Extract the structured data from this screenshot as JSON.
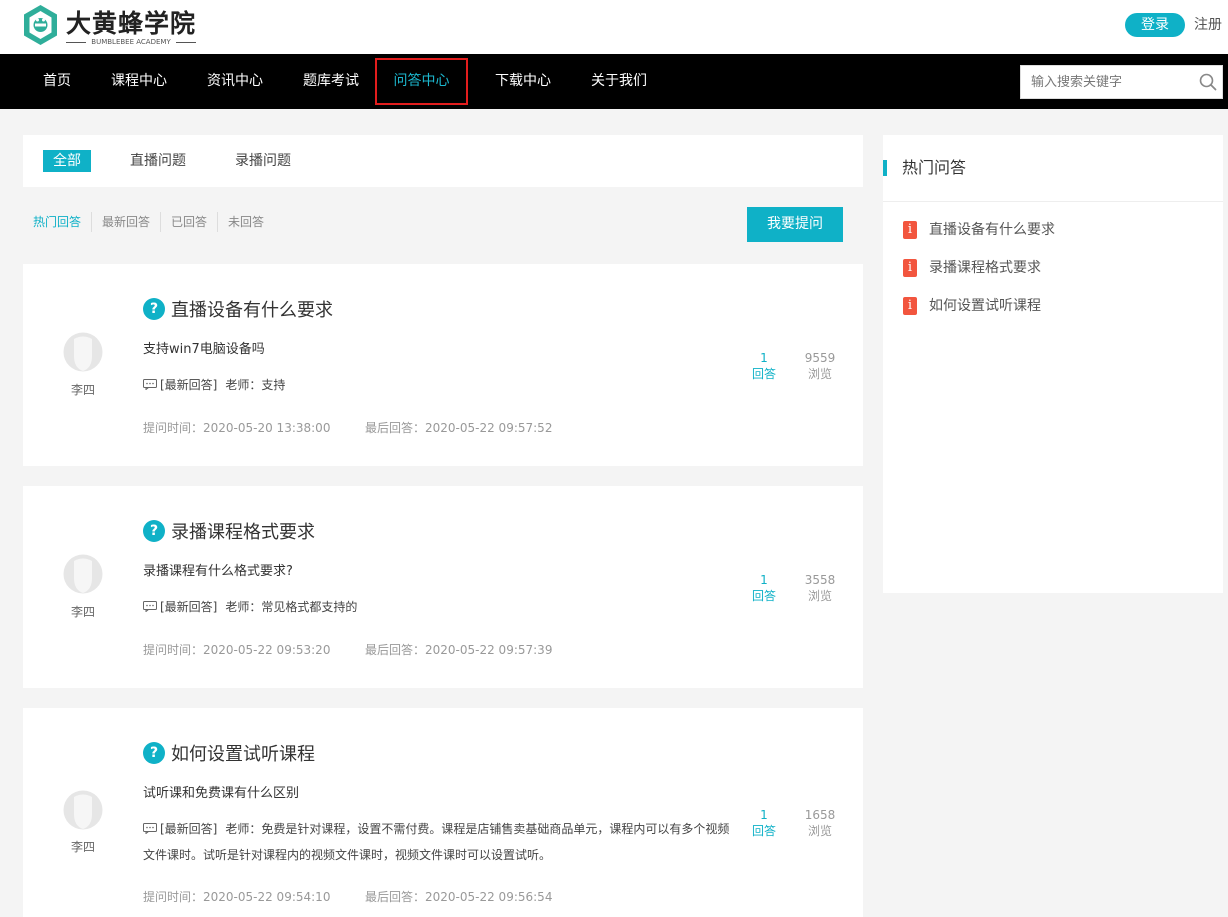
{
  "brand": {
    "name": "大黄蜂学院",
    "subtitle": "BUMBLEBEE ACADEMY"
  },
  "header": {
    "login_label": "登录",
    "register_label": "注册"
  },
  "nav": {
    "items": [
      {
        "label": "首页"
      },
      {
        "label": "课程中心"
      },
      {
        "label": "资讯中心"
      },
      {
        "label": "题库考试"
      },
      {
        "label": "问答中心",
        "active": true
      },
      {
        "label": "下载中心"
      },
      {
        "label": "关于我们"
      }
    ],
    "search_placeholder": "输入搜索关键字",
    "search_icon": "search-icon"
  },
  "tabs": [
    {
      "label": "全部",
      "active": true
    },
    {
      "label": "直播问题"
    },
    {
      "label": "录播问题"
    }
  ],
  "subfilters": [
    {
      "label": "热门回答",
      "active": true
    },
    {
      "label": "最新回答"
    },
    {
      "label": "已回答"
    },
    {
      "label": "未回答"
    }
  ],
  "ask_button_label": "我要提问",
  "questions": [
    {
      "title": "直播设备有什么要求",
      "description": "支持win7电脑设备吗",
      "author": "李四",
      "latest_tag": "[最新回答]",
      "latest_answer": "老师：支持",
      "ask_time": "提问时间：2020-05-20 13:38:00",
      "last_answer_time": "最后回答：2020-05-22 09:57:52",
      "answers_count": "1",
      "answers_label": "回答",
      "views_count": "9559",
      "views_label": "浏览"
    },
    {
      "title": "录播课程格式要求",
      "description": "录播课程有什么格式要求?",
      "author": "李四",
      "latest_tag": "[最新回答]",
      "latest_answer": "老师：常见格式都支持的",
      "ask_time": "提问时间：2020-05-22 09:53:20",
      "last_answer_time": "最后回答：2020-05-22 09:57:39",
      "answers_count": "1",
      "answers_label": "回答",
      "views_count": "3558",
      "views_label": "浏览"
    },
    {
      "title": "如何设置试听课程",
      "description": "试听课和免费课有什么区别",
      "author": "李四",
      "latest_tag": "[最新回答]",
      "latest_answer": "老师：免费是针对课程，设置不需付费。课程是店铺售卖基础商品单元，课程内可以有多个视频文件课时。试听是针对课程内的视频文件课时，视频文件课时可以设置试听。",
      "ask_time": "提问时间：2020-05-22 09:54:10",
      "last_answer_time": "最后回答：2020-05-22 09:56:54",
      "answers_count": "1",
      "answers_label": "回答",
      "views_count": "1658",
      "views_label": "浏览"
    }
  ],
  "sidebar": {
    "title": "热门问答",
    "badge_symbol": "i",
    "items": [
      {
        "label": "直播设备有什么要求"
      },
      {
        "label": "录播课程格式要求"
      },
      {
        "label": "如何设置试听课程"
      }
    ]
  },
  "colors": {
    "accent": "#0fb1c7",
    "nav_bg": "#000000",
    "highlight_border": "#e21d1d",
    "hot_badge": "#f2553e",
    "page_bg": "#f4f4f4"
  }
}
